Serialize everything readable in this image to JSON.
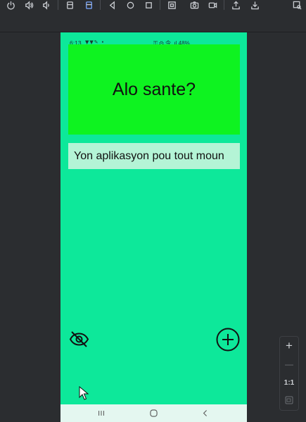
{
  "toolbar": {
    "buttons": [
      {
        "name": "power-icon"
      },
      {
        "name": "volume-up-icon"
      },
      {
        "name": "volume-down-icon"
      },
      {
        "name": "rotate-left-icon"
      },
      {
        "name": "rotate-right-icon"
      },
      {
        "name": "back-icon"
      },
      {
        "name": "home-icon"
      },
      {
        "name": "overview-icon"
      },
      {
        "name": "fold-icon"
      },
      {
        "name": "screenshot-icon"
      },
      {
        "name": "screen-record-icon"
      },
      {
        "name": "share-icon"
      },
      {
        "name": "download-icon"
      },
      {
        "name": "layout-inspector-icon"
      }
    ]
  },
  "status_bar": {
    "time": "6:13",
    "right": "⚿ ⚙ 令 .ıl 48%"
  },
  "hero": {
    "title": "Alo sante?",
    "color": "#0ef320"
  },
  "subtitle": {
    "text": "Yon aplikasyon pou tout moun"
  },
  "actions": {
    "hide_icon": "eye-off-icon",
    "add_icon": "plus-circle-icon"
  },
  "zoom": {
    "zoom_in": "+",
    "zoom_out": "—",
    "actual_size": "1:1"
  },
  "theme": {
    "screen_bg": "#0de89a",
    "hero_bg": "#0ef320",
    "subtitle_bg": "#b4f4d6"
  }
}
